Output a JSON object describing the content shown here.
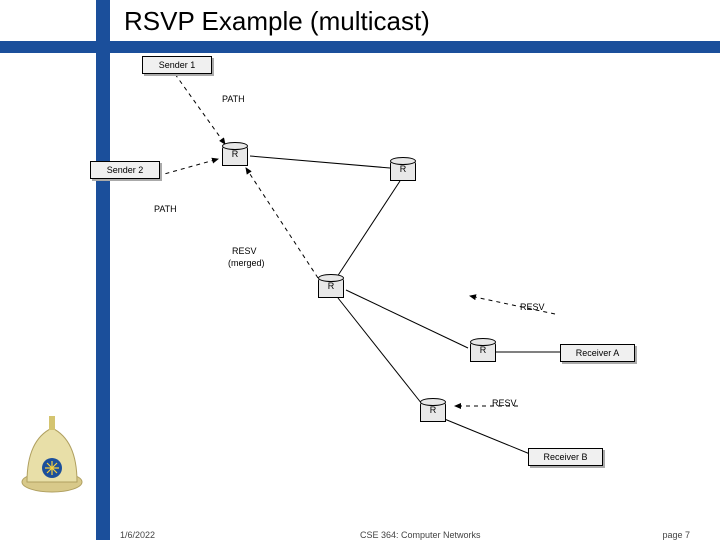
{
  "title": "RSVP Example (multicast)",
  "nodes": {
    "sender1": "Sender 1",
    "sender2": "Sender 2",
    "receiverA": "Receiver A",
    "receiverB": "Receiver B",
    "r": "R"
  },
  "labels": {
    "path1": "PATH",
    "path2": "PATH",
    "resv_merged_1": "RESV",
    "resv_merged_2": "(merged)",
    "resv1": "RESV",
    "resv2": "RESV"
  },
  "footer": {
    "date": "1/6/2022",
    "course": "CSE 364: Computer Networks",
    "page": "page 7"
  },
  "colors": {
    "brand": "#1b4f9b"
  }
}
